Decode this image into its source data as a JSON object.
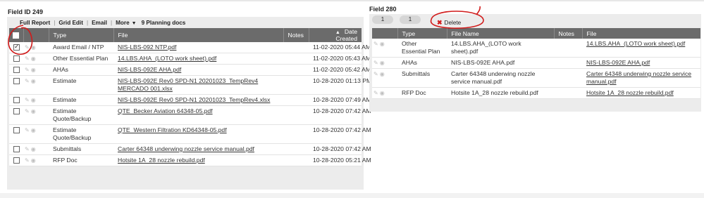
{
  "left": {
    "title": "Field ID 249",
    "toolbar": {
      "full_report": "Full Report",
      "grid_edit": "Grid Edit",
      "email": "Email",
      "more": "More",
      "docs": "9 Planning docs"
    },
    "headers": {
      "type": "Type",
      "file": "File",
      "notes": "Notes",
      "date": "Date Created"
    },
    "rows": [
      {
        "checked": true,
        "type": "Award Email / NTP",
        "file": "NIS-LBS-092 NTP.pdf",
        "notes": "",
        "date": "11-02-2020 05:44 AM"
      },
      {
        "checked": false,
        "type": "Other Essential Plan",
        "file": "14.LBS.AHA_(LOTO work sheet).pdf",
        "notes": "",
        "date": "11-02-2020 05:43 AM"
      },
      {
        "checked": false,
        "type": "AHAs",
        "file": "NIS-LBS-092E AHA.pdf",
        "notes": "",
        "date": "11-02-2020 05:42 AM"
      },
      {
        "checked": false,
        "type": "Estimate",
        "file": "NIS-LBS-092E Rev0 SPD-N1 20201023_TempRev4 MERCADO 001.xlsx",
        "notes": "",
        "date": "10-28-2020 01:13 PM"
      },
      {
        "checked": false,
        "type": "Estimate",
        "file": "NIS-LBS-092E Rev0 SPD-N1 20201023_TempRev4.xlsx",
        "notes": "",
        "date": "10-28-2020 07:49 AM"
      },
      {
        "checked": false,
        "type": "Estimate Quote/Backup",
        "file": "QTE_Becker Aviation 64348-05.pdf",
        "notes": "",
        "date": "10-28-2020 07:42 AM"
      },
      {
        "checked": false,
        "type": "Estimate Quote/Backup",
        "file": "QTE_Western Filtration KD64348-05.pdf",
        "notes": "",
        "date": "10-28-2020 07:42 AM"
      },
      {
        "checked": false,
        "type": "Submittals",
        "file": "Carter 64348 underwing nozzle service manual.pdf",
        "notes": "",
        "date": "10-28-2020 07:42 AM"
      },
      {
        "checked": false,
        "type": "RFP Doc",
        "file": "Hotsite 1A_28 nozzle rebuild.pdf",
        "notes": "",
        "date": "10-28-2020 05:21 AM"
      }
    ]
  },
  "right": {
    "title": "Field 280",
    "pager": {
      "a": "1",
      "b": "1"
    },
    "delete_label": "Delete",
    "headers": {
      "type": "Type",
      "file_name": "File Name",
      "notes": "Notes",
      "file": "File"
    },
    "rows": [
      {
        "type": "Other Essential Plan",
        "file_name": "14.LBS.AHA_(LOTO work sheet).pdf",
        "notes": "",
        "file": "14.LBS.AHA_(LOTO work sheet).pdf"
      },
      {
        "type": "AHAs",
        "file_name": "NIS-LBS-092E AHA.pdf",
        "notes": "",
        "file": "NIS-LBS-092E AHA.pdf"
      },
      {
        "type": "Submittals",
        "file_name": "Carter 64348 underwing nozzle service manual.pdf",
        "notes": "",
        "file": "Carter 64348 underwing nozzle service manual.pdf"
      },
      {
        "type": "RFP Doc",
        "file_name": "Hotsite 1A_28 nozzle rebuild.pdf",
        "notes": "",
        "file": "Hotsite 1A_28 nozzle rebuild.pdf"
      }
    ]
  },
  "icons": {
    "edit": "pencil-icon",
    "view": "eye-icon",
    "sort": "sort-caret-icon",
    "delete": "delete-x-icon",
    "more": "chevron-down-icon"
  },
  "colors": {
    "header_bg": "#6b6b6b",
    "panel_bg": "#ececec",
    "annotation": "#d11b1b",
    "delete_x": "#d11b1b"
  }
}
